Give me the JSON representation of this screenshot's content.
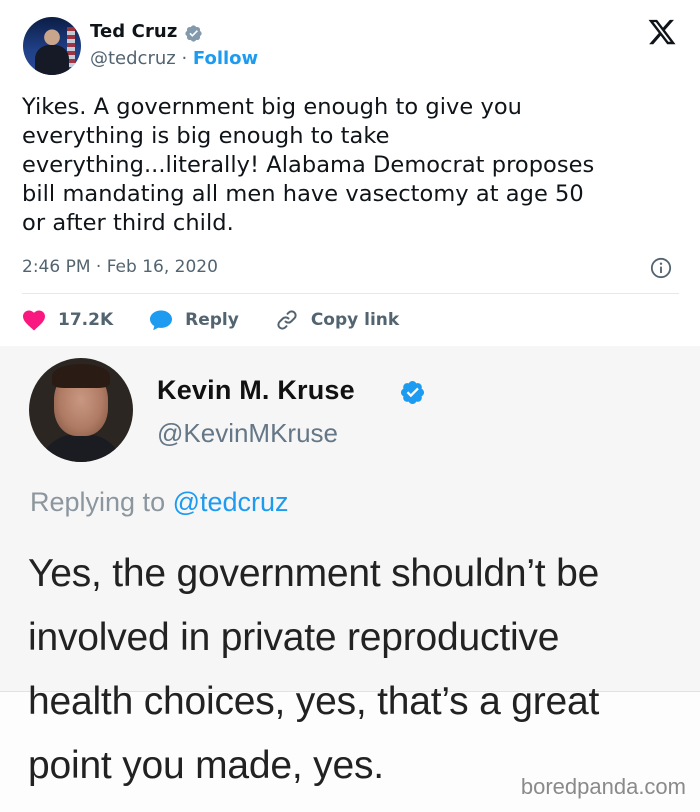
{
  "tweet": {
    "author_name": "Ted Cruz",
    "handle": "@tedcruz",
    "separator": " · ",
    "follow_label": "Follow",
    "text": "Yikes.  A government big enough to give you\neverything is big enough to take\neverything...literally! Alabama Democrat proposes\nbill mandating all men have vasectomy at age 50\nor after third child.",
    "timestamp": "2:46 PM · Feb 16, 2020",
    "like_count": "17.2K",
    "reply_label": "Reply",
    "copy_link_label": "Copy link"
  },
  "reply": {
    "author_name": "Kevin M. Kruse",
    "handle": "@KevinMKruse",
    "replying_prefix": "Replying to ",
    "replying_mention": "@tedcruz",
    "text": "Yes, the government shouldn’t be\ninvolved in private reproductive\nhealth choices, yes, that’s a great\npoint you made, yes."
  },
  "watermark": "boredpanda.com",
  "colors": {
    "accent": "#1d9bf0",
    "like": "#f91880",
    "muted": "#536471"
  },
  "icons": {
    "close": "x-logo-icon",
    "verified": "verified-badge-icon",
    "info": "info-icon",
    "heart": "heart-icon",
    "reply": "reply-bubble-icon",
    "link": "link-icon"
  }
}
